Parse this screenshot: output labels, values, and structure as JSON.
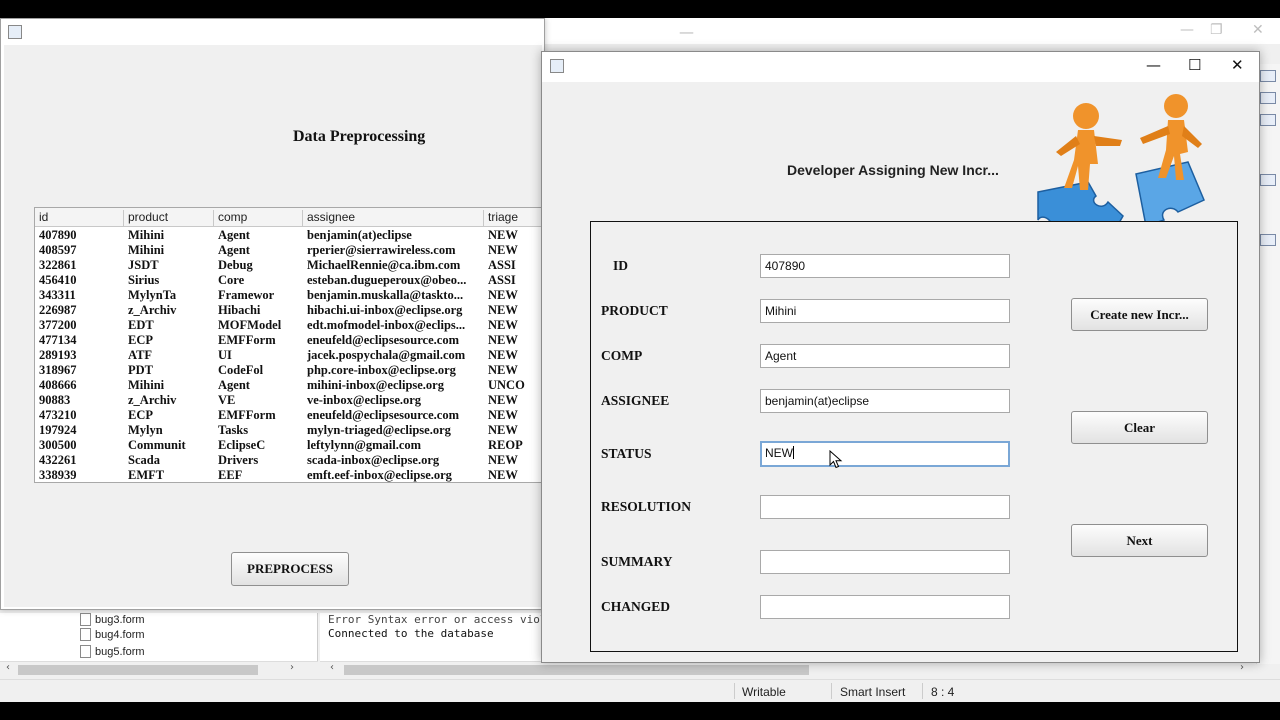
{
  "preprocess_window": {
    "heading": "Data Preprocessing",
    "columns": [
      "id",
      "product",
      "comp",
      "assignee",
      "triage"
    ],
    "rows": [
      [
        "407890",
        "Mihini",
        "Agent",
        "benjamin(at)eclipse",
        "NEW"
      ],
      [
        "408597",
        "Mihini",
        "Agent",
        "rperier@sierrawireless.com",
        "NEW"
      ],
      [
        "322861",
        "JSDT",
        "Debug",
        "MichaelRennie@ca.ibm.com",
        "ASSI"
      ],
      [
        "456410",
        "Sirius",
        "Core",
        "esteban.dugueperoux@obeo...",
        "ASSI"
      ],
      [
        "343311",
        "MylynTa",
        "Framewor",
        "benjamin.muskalla@taskto...",
        "NEW"
      ],
      [
        "226987",
        "z_Archiv",
        "Hibachi",
        "hibachi.ui-inbox@eclipse.org",
        "NEW"
      ],
      [
        "377200",
        "EDT",
        "MOFModel",
        "edt.mofmodel-inbox@eclips...",
        "NEW"
      ],
      [
        "477134",
        "ECP",
        "EMFForm",
        "eneufeld@eclipsesource.com",
        "NEW"
      ],
      [
        "289193",
        "ATF",
        "UI",
        "jacek.pospychala@gmail.com",
        "NEW"
      ],
      [
        "318967",
        "PDT",
        "CodeFol",
        "php.core-inbox@eclipse.org",
        "NEW"
      ],
      [
        "408666",
        "Mihini",
        "Agent",
        "mihini-inbox@eclipse.org",
        "UNCO"
      ],
      [
        "90883",
        "z_Archiv",
        "VE",
        "ve-inbox@eclipse.org",
        "NEW"
      ],
      [
        "473210",
        "ECP",
        "EMFForm",
        "eneufeld@eclipsesource.com",
        "NEW"
      ],
      [
        "197924",
        "Mylyn",
        "Tasks",
        "mylyn-triaged@eclipse.org",
        "NEW"
      ],
      [
        "300500",
        "Communit",
        "EclipseC",
        "leftylynn@gmail.com",
        "REOP"
      ],
      [
        "432261",
        "Scada",
        "Drivers",
        "scada-inbox@eclipse.org",
        "NEW"
      ],
      [
        "338939",
        "EMFT",
        "EEF",
        "emft.eef-inbox@eclipse.org",
        "NEW"
      ]
    ],
    "preprocess_button": "PREPROCESS"
  },
  "assign_window": {
    "heading": "Developer Assigning New Incr...",
    "fields": {
      "id": {
        "label": "ID",
        "value": "407890"
      },
      "product": {
        "label": "PRODUCT",
        "value": "Mihini"
      },
      "comp": {
        "label": "COMP",
        "value": "Agent"
      },
      "assignee": {
        "label": "ASSIGNEE",
        "value": "benjamin(at)eclipse"
      },
      "status": {
        "label": "STATUS",
        "value": "NEW"
      },
      "resolution": {
        "label": "RESOLUTION",
        "value": ""
      },
      "summary": {
        "label": "SUMMARY",
        "value": ""
      },
      "changed": {
        "label": "CHANGED",
        "value": ""
      }
    },
    "buttons": {
      "create": "Create new Incr...",
      "clear": "Clear",
      "next": "Next"
    },
    "window_controls": {
      "minimize": "—",
      "maximize": "☐",
      "close": "✕"
    }
  },
  "background": {
    "tree_files": [
      "bug3.form",
      "bug4.form",
      "bug5.form"
    ],
    "console_lines": [
      "Error Syntax error or access viol",
      "Connected to the database"
    ],
    "statusbar": {
      "writable": "Writable",
      "insert_mode": "Smart Insert",
      "position": "8 : 4"
    }
  },
  "colors": {
    "panel_bg": "#f0f0f0",
    "focus_border": "#7aa7d6",
    "figure_orange": "#f0932b",
    "puzzle_blue": "#3a8fd8"
  }
}
